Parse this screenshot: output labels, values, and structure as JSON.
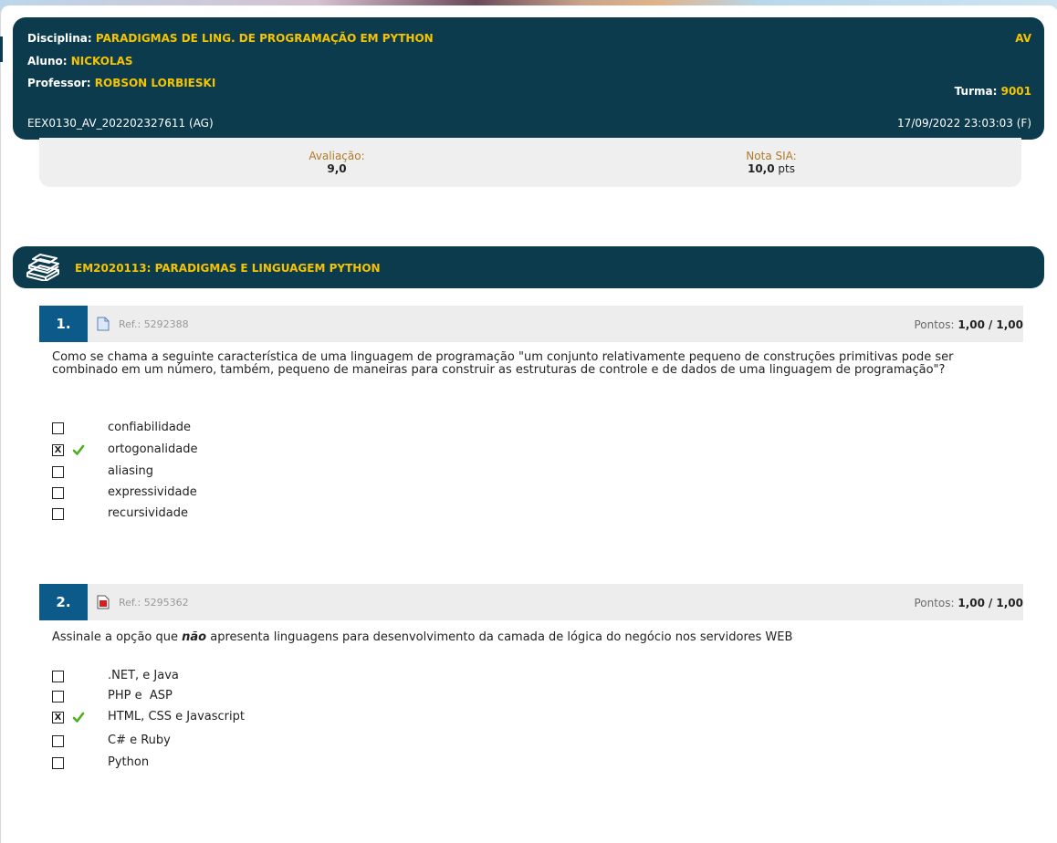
{
  "header": {
    "disciplina_label": "Disciplina:",
    "disciplina_value": "PARADIGMAS DE LING. DE PROGRAMAÇÃO EM PYTHON",
    "type": "AV",
    "aluno_label": "Aluno:",
    "aluno_value": "NICKOLAS",
    "professor_label": "Professor:",
    "professor_value": "ROBSON LORBIESKI",
    "turma_label": "Turma:",
    "turma_value": "9001",
    "code": "EEX0130_AV_202202327611 (AG)",
    "datetime": "17/09/2022 23:03:03 (F)"
  },
  "grades": {
    "avaliacao_label": "Avaliação:",
    "avaliacao_value": "9,0",
    "nota_label": "Nota SIA:",
    "nota_value": "10,0",
    "nota_unit": "pts"
  },
  "section": {
    "title": "EM2020113: PARADIGMAS E LINGUAGEM PYTHON",
    "icon": "books-icon"
  },
  "questions": [
    {
      "number": "1.",
      "ref": "Ref.: 5292388",
      "points_label": "Pontos:",
      "points": "1,00",
      "points_max": "/ 1,00",
      "text": "Como se chama a seguinte característica de uma linguagem de programação \"um conjunto relativamente pequeno de construções primitivas pode ser combinado em um número, também, pequeno de maneiras para construir as estruturas de controle e de dados de uma linguagem de programação\"?",
      "options": [
        "confiabilidade",
        "ortogonalidade",
        "aliasing",
        "expressividade",
        "recursividade"
      ],
      "selected_index": 1,
      "correct_index": 1
    },
    {
      "number": "2.",
      "ref": "Ref.: 5295362",
      "points_label": "Pontos:",
      "points": "1,00",
      "points_max": "/ 1,00",
      "text_before": "Assinale a opção que ",
      "text_emphasis": "não",
      "text_after": " apresenta linguagens para desenvolvimento da camada de lógica do negócio nos servidores WEB",
      "options": [
        ".NET, e Java",
        "PHP e  ASP",
        "HTML, CSS e Javascript",
        "C# e Ruby",
        "Python"
      ],
      "selected_index": 2,
      "correct_index": 2
    }
  ],
  "colors": {
    "header_bg": "#0c3b4d",
    "accent_yellow": "#f5c400",
    "question_number_bg": "#0c5a8a",
    "check_green": "#4caf1f"
  }
}
